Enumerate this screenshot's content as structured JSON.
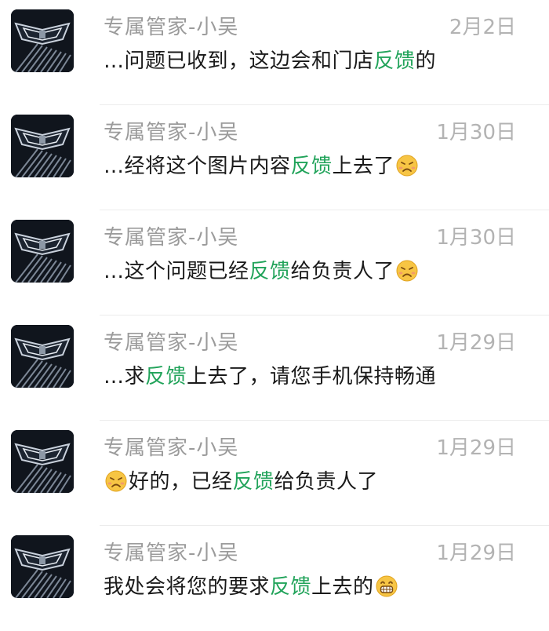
{
  "chat_list": {
    "items": [
      {
        "name": "专属管家-小吴",
        "date": "2月2日",
        "preview": {
          "before": "…问题已收到，这边会和门店",
          "keyword": "反馈",
          "after": "的",
          "emoji_before": "",
          "emoji_after": ""
        }
      },
      {
        "name": "专属管家-小吴",
        "date": "1月30日",
        "preview": {
          "before": "…经将这个图片内容",
          "keyword": "反馈",
          "after": "上去了",
          "emoji_before": "",
          "emoji_after": "sad-face-emoji"
        }
      },
      {
        "name": "专属管家-小吴",
        "date": "1月30日",
        "preview": {
          "before": "…这个问题已经",
          "keyword": "反馈",
          "after": "给负责人了",
          "emoji_before": "",
          "emoji_after": "sad-face-emoji"
        }
      },
      {
        "name": "专属管家-小吴",
        "date": "1月29日",
        "preview": {
          "before": "…求",
          "keyword": "反馈",
          "after": "上去了，请您手机保持畅通",
          "emoji_before": "",
          "emoji_after": ""
        }
      },
      {
        "name": "专属管家-小吴",
        "date": "1月29日",
        "preview": {
          "before": "好的，已经",
          "keyword": "反馈",
          "after": "给负责人了",
          "emoji_before": "sad-face-emoji",
          "emoji_after": ""
        }
      },
      {
        "name": "专属管家-小吴",
        "date": "1月29日",
        "preview": {
          "before": "我处会将您的要求",
          "keyword": "反馈",
          "after": "上去的",
          "emoji_before": "",
          "emoji_after": "grin-face-emoji"
        }
      }
    ]
  },
  "colors": {
    "keyword_highlight": "#21a35a",
    "name_text": "#9b9b9b",
    "date_text": "#b3b3b3",
    "preview_text": "#1a1a1a",
    "divider": "#ececec"
  },
  "icons": {
    "avatar": "car-grille-emblem-avatar-icon"
  }
}
